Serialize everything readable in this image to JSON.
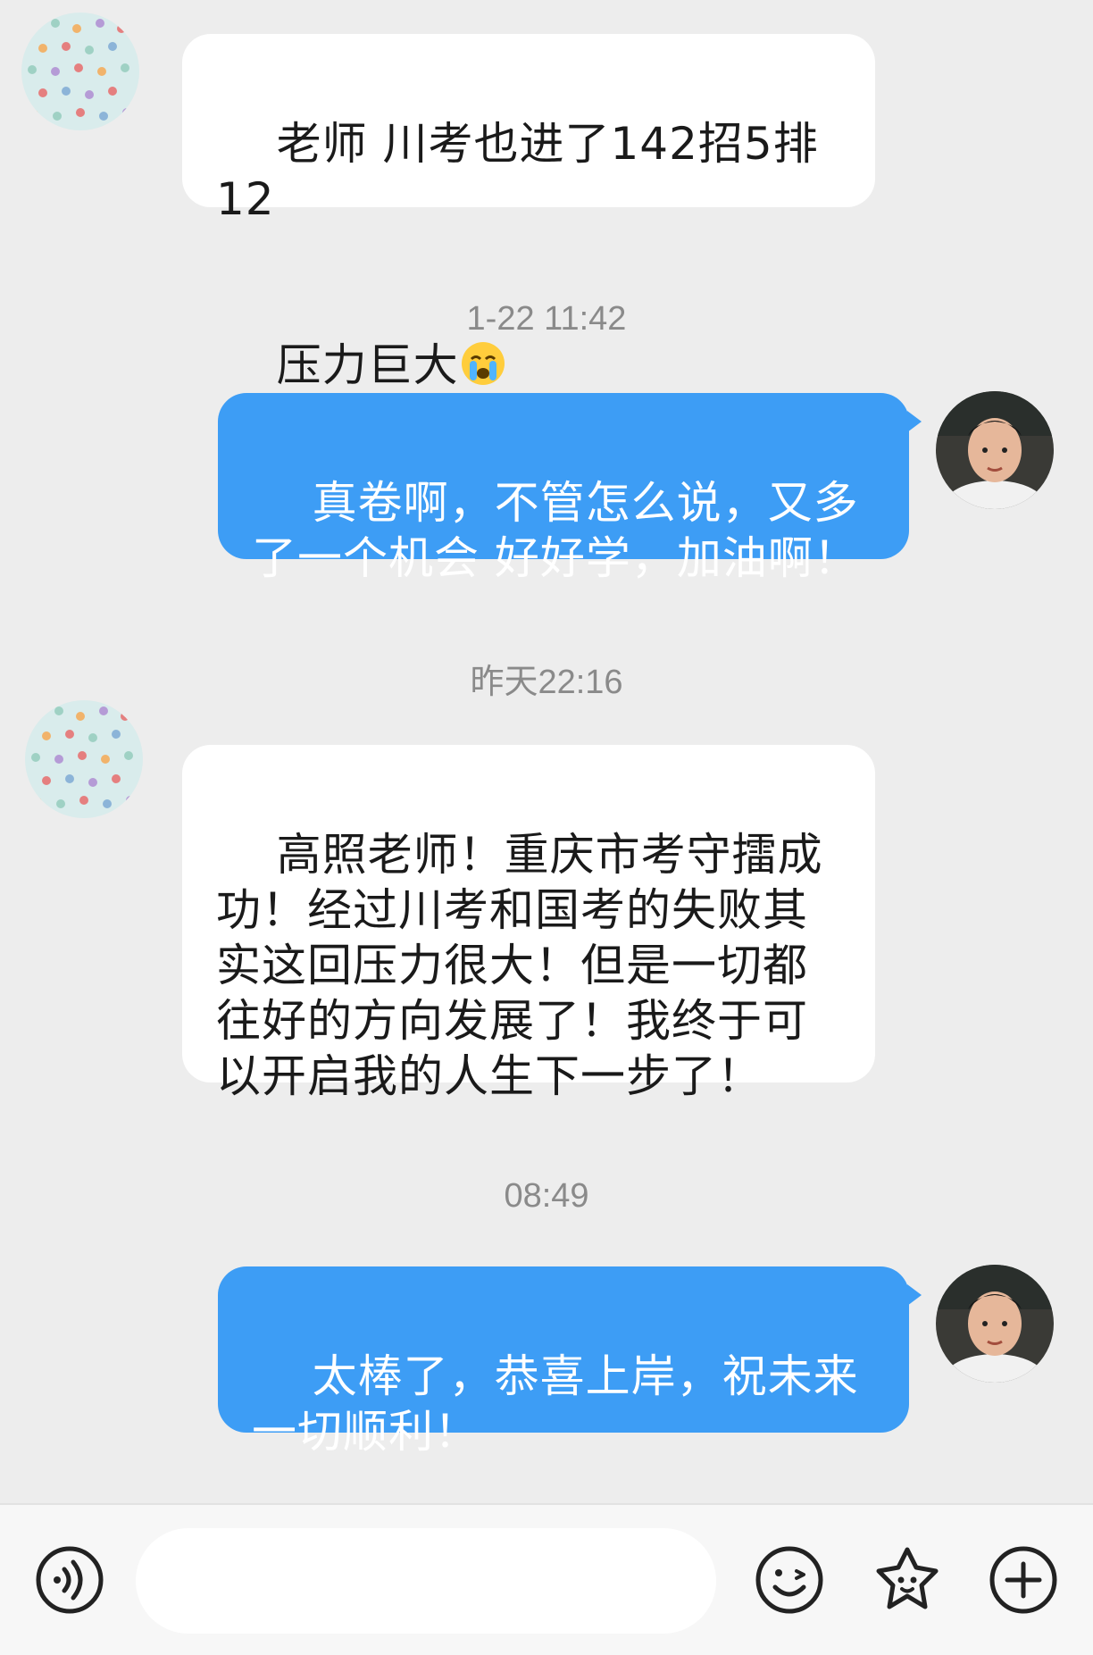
{
  "messages": [
    {
      "side": "in",
      "text_line1": "老师 川考也进了142招5排12",
      "text_line2": "压力巨大",
      "emoji": "crying-emoji"
    },
    {
      "timestamp": "1-22 11:42"
    },
    {
      "side": "out",
      "text": "真卷啊，不管怎么说，又多了一个机会 好好学，加油啊！"
    },
    {
      "timestamp": "昨天22:16"
    },
    {
      "side": "in",
      "text": "高照老师！重庆市考守擂成功！经过川考和国考的失败其实这回压力很大！但是一切都往好的方向发展了！我终于可以开启我的人生下一步了！"
    },
    {
      "timestamp": "08:49"
    },
    {
      "side": "out",
      "text": "太棒了，恭喜上岸，祝未来一切顺利！"
    }
  ],
  "input": {
    "placeholder": "",
    "value": ""
  },
  "toolbar": {
    "icons": [
      "voice-icon",
      "emoji-icon",
      "sticker-icon",
      "plus-icon"
    ]
  },
  "colors": {
    "outgoing_bubble": "#3d9df5",
    "incoming_bubble": "#ffffff",
    "background": "#ededed"
  }
}
